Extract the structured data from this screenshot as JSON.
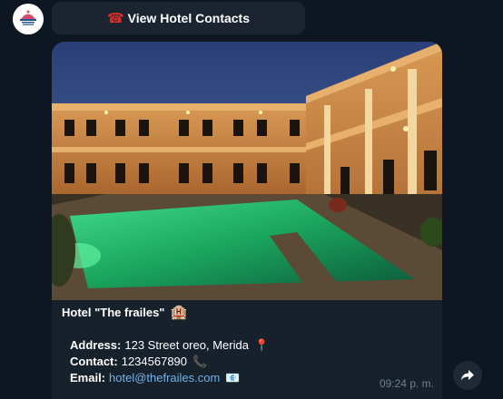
{
  "header": {
    "button_label": "View Hotel Contacts",
    "button_icon": "telephone-icon"
  },
  "message": {
    "photo_icon": "hotel-photo",
    "title": "Hotel \"The frailes\"",
    "title_icon": "hotel-icon",
    "address_label": "Address:",
    "address_value": "123 Street oreo, Merida",
    "address_icon": "pin-icon",
    "contact_label": "Contact:",
    "contact_value": "1234567890",
    "contact_icon": "phone-icon",
    "email_label": "Email:",
    "email_value": "hotel@thefrailes.com",
    "email_icon": "envelope-icon",
    "timestamp": "09:24 p. m."
  },
  "colors": {
    "background": "#0e1621",
    "bubble": "#17212b",
    "link": "#71b2ec",
    "timestamp": "#6d7f8f"
  }
}
